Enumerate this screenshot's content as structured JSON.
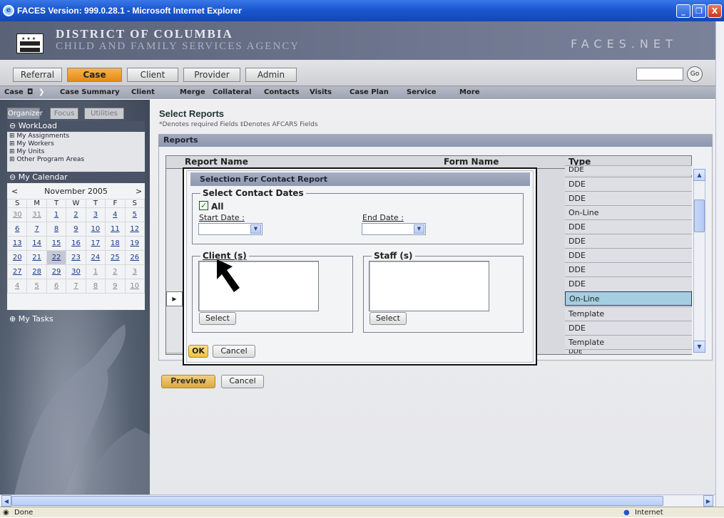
{
  "window": {
    "title": "FACES Version: 999.0.28.1 - Microsoft Internet Explorer",
    "min": "_",
    "max": "❐",
    "close": "X"
  },
  "header": {
    "org_line1": "DISTRICT OF COLUMBIA",
    "org_line2": "CHILD AND FAMILY SERVICES AGENCY",
    "brand": "FACES.NET"
  },
  "tabs": [
    "Referral",
    "Case",
    "Client",
    "Provider",
    "Admin"
  ],
  "go_label": "Go",
  "subnav": [
    "Case",
    "Case Summary",
    "Client",
    "Merge",
    "Collateral",
    "Contacts",
    "Visits",
    "Case Plan",
    "Service",
    "More"
  ],
  "left": {
    "tabs": [
      "Organizer",
      "Focus",
      "Utilities"
    ],
    "workload_title": "WorkLoad",
    "workload_items": [
      "My Assignments",
      "My Workers",
      "My Units",
      "Other Program Areas"
    ],
    "calendar_title": "My Calendar",
    "calendar_month": "November 2005",
    "calendar_prev": "<",
    "calendar_next": ">",
    "weekdays": [
      "S",
      "M",
      "T",
      "W",
      "T",
      "F",
      "S"
    ],
    "weeks": [
      [
        "30",
        "31",
        "1",
        "2",
        "3",
        "4",
        "5"
      ],
      [
        "6",
        "7",
        "8",
        "9",
        "10",
        "11",
        "12"
      ],
      [
        "13",
        "14",
        "15",
        "16",
        "17",
        "18",
        "19"
      ],
      [
        "20",
        "21",
        "22",
        "23",
        "24",
        "25",
        "26"
      ],
      [
        "27",
        "28",
        "29",
        "30",
        "1",
        "2",
        "3"
      ],
      [
        "4",
        "5",
        "6",
        "7",
        "8",
        "9",
        "10"
      ]
    ],
    "tasks_title": "My Tasks"
  },
  "main": {
    "title": "Select Reports",
    "req_note": "*Denotes required Fields  ‡Denotes AFCARS Fields",
    "reports_header": "Reports",
    "col_report": "Report Name",
    "col_form": "Form Name",
    "col_type": "Type",
    "types": [
      "DDE",
      "DDE",
      "DDE",
      "On-Line",
      "DDE",
      "DDE",
      "DDE",
      "DDE",
      "DDE",
      "On-Line",
      "Template",
      "DDE",
      "Template",
      "DDE"
    ],
    "preview_label": "Preview",
    "cancel_label": "Cancel"
  },
  "dialog": {
    "title": "Selection For Contact Report",
    "dates_legend": "Select Contact Dates",
    "all_label": "All",
    "all_checked": true,
    "start_label": "Start Date :",
    "end_label": "End Date :",
    "client_legend": "Client (s)",
    "staff_legend": "Staff (s)",
    "select_label": "Select",
    "ok_label": "OK",
    "cancel_label": "Cancel"
  },
  "status": {
    "text": "Done",
    "zone": "Internet"
  }
}
